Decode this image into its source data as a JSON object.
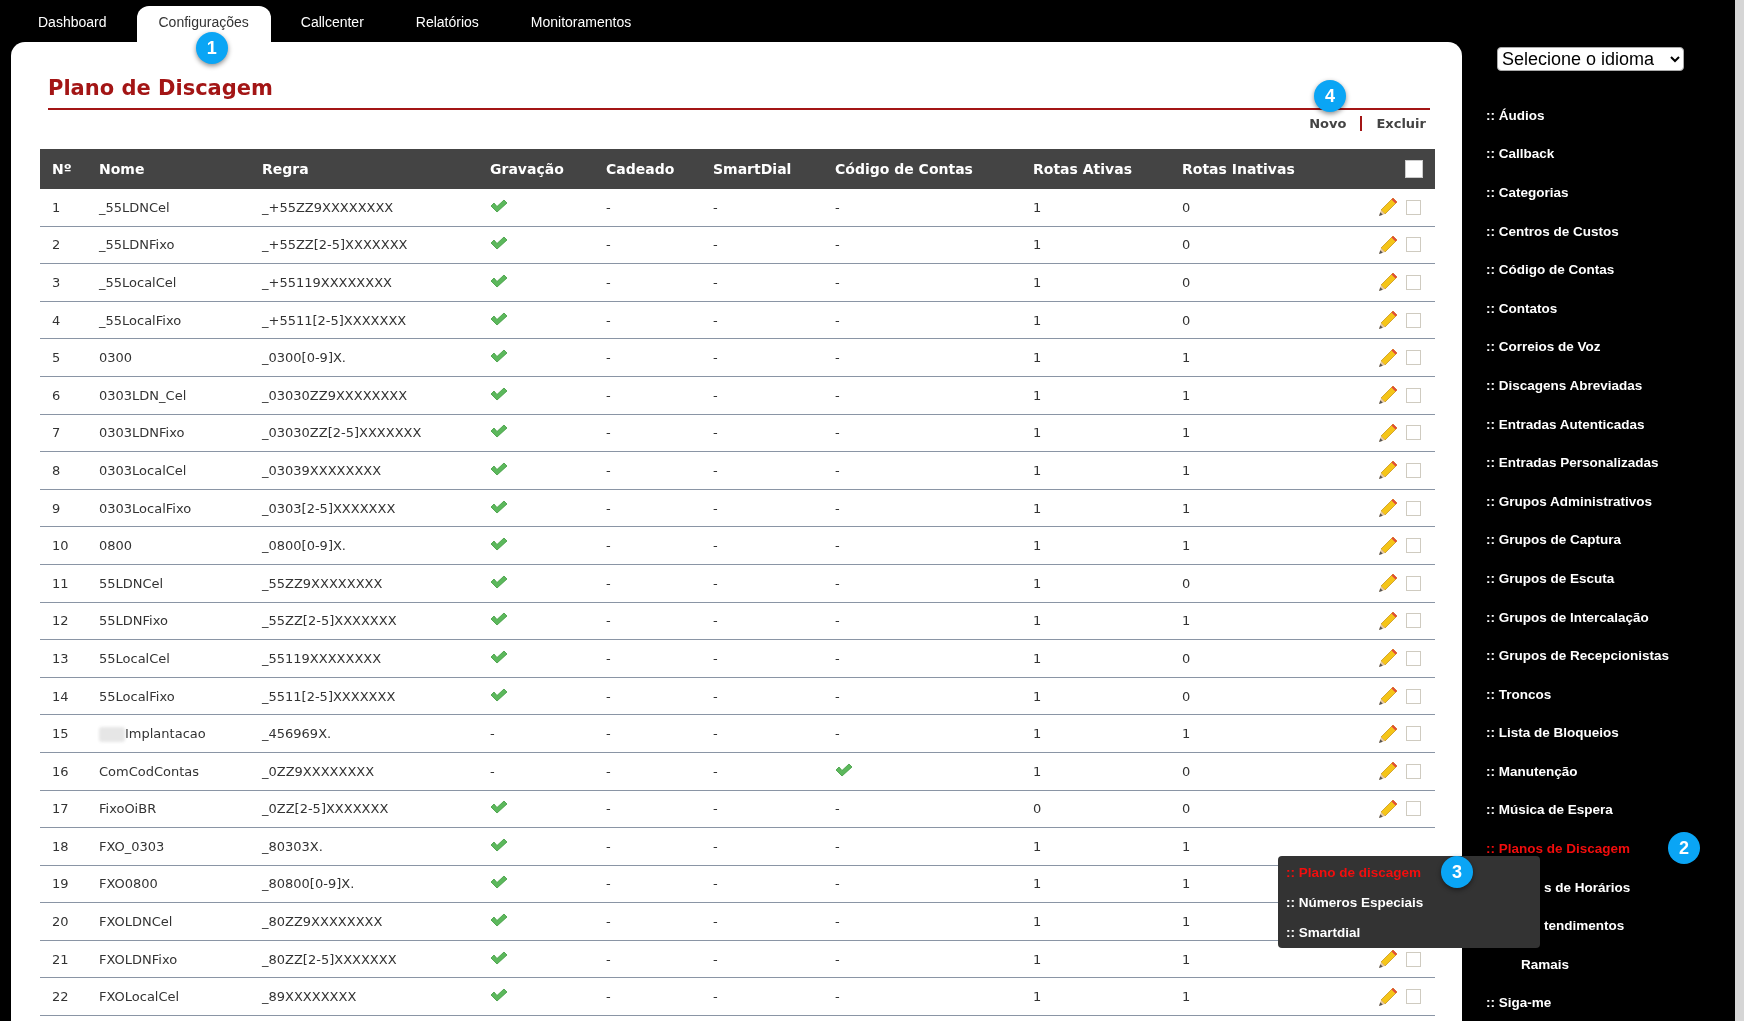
{
  "tabs": [
    {
      "label": "Dashboard",
      "selected": false
    },
    {
      "label": "Configurações",
      "selected": true,
      "badge": "1"
    },
    {
      "label": "Callcenter",
      "selected": false
    },
    {
      "label": "Relatórios",
      "selected": false
    },
    {
      "label": "Monitoramentos",
      "selected": false
    }
  ],
  "page": {
    "title": "Plano de Discagem",
    "badge": "4",
    "actions": [
      "Novo",
      "Excluir"
    ]
  },
  "table": {
    "columns": [
      "Nº",
      "Nome",
      "Regra",
      "Gravação",
      "Cadeado",
      "SmartDial",
      "Código de Contas",
      "Rotas Ativas",
      "Rotas Inativas"
    ],
    "select_all": {
      "checked": false
    },
    "rows": [
      {
        "n": "1",
        "name": "_55LDNCel",
        "rule": "_+55ZZ9XXXXXXXX",
        "recording": true,
        "lock": "-",
        "smartdial": "-",
        "codes": "-",
        "active": "1",
        "inactive": "0",
        "checked": false
      },
      {
        "n": "2",
        "name": "_55LDNFixo",
        "rule": "_+55ZZ[2-5]XXXXXXX",
        "recording": true,
        "lock": "-",
        "smartdial": "-",
        "codes": "-",
        "active": "1",
        "inactive": "0",
        "checked": false
      },
      {
        "n": "3",
        "name": "_55LocalCel",
        "rule": "_+55119XXXXXXXX",
        "recording": true,
        "lock": "-",
        "smartdial": "-",
        "codes": "-",
        "active": "1",
        "inactive": "0",
        "checked": false
      },
      {
        "n": "4",
        "name": "_55LocalFixo",
        "rule": "_+5511[2-5]XXXXXXX",
        "recording": true,
        "lock": "-",
        "smartdial": "-",
        "codes": "-",
        "active": "1",
        "inactive": "0",
        "checked": false
      },
      {
        "n": "5",
        "name": "0300",
        "rule": "_0300[0-9]X.",
        "recording": true,
        "lock": "-",
        "smartdial": "-",
        "codes": "-",
        "active": "1",
        "inactive": "1",
        "checked": false
      },
      {
        "n": "6",
        "name": "0303LDN_Cel",
        "rule": "_03030ZZ9XXXXXXXX",
        "recording": true,
        "lock": "-",
        "smartdial": "-",
        "codes": "-",
        "active": "1",
        "inactive": "1",
        "checked": false
      },
      {
        "n": "7",
        "name": "0303LDNFixo",
        "rule": "_03030ZZ[2-5]XXXXXXX",
        "recording": true,
        "lock": "-",
        "smartdial": "-",
        "codes": "-",
        "active": "1",
        "inactive": "1",
        "checked": false
      },
      {
        "n": "8",
        "name": "0303LocalCel",
        "rule": "_03039XXXXXXXX",
        "recording": true,
        "lock": "-",
        "smartdial": "-",
        "codes": "-",
        "active": "1",
        "inactive": "1",
        "checked": false
      },
      {
        "n": "9",
        "name": "0303LocalFixo",
        "rule": "_0303[2-5]XXXXXXX",
        "recording": true,
        "lock": "-",
        "smartdial": "-",
        "codes": "-",
        "active": "1",
        "inactive": "1",
        "checked": false
      },
      {
        "n": "10",
        "name": "0800",
        "rule": "_0800[0-9]X.",
        "recording": true,
        "lock": "-",
        "smartdial": "-",
        "codes": "-",
        "active": "1",
        "inactive": "1",
        "checked": false
      },
      {
        "n": "11",
        "name": "55LDNCel",
        "rule": "_55ZZ9XXXXXXXX",
        "recording": true,
        "lock": "-",
        "smartdial": "-",
        "codes": "-",
        "active": "1",
        "inactive": "0",
        "checked": false
      },
      {
        "n": "12",
        "name": "55LDNFixo",
        "rule": "_55ZZ[2-5]XXXXXXX",
        "recording": true,
        "lock": "-",
        "smartdial": "-",
        "codes": "-",
        "active": "1",
        "inactive": "1",
        "checked": false
      },
      {
        "n": "13",
        "name": "55LocalCel",
        "rule": "_55119XXXXXXXX",
        "recording": true,
        "lock": "-",
        "smartdial": "-",
        "codes": "-",
        "active": "1",
        "inactive": "0",
        "checked": false
      },
      {
        "n": "14",
        "name": "55LocalFixo",
        "rule": "_5511[2-5]XXXXXXX",
        "recording": true,
        "lock": "-",
        "smartdial": "-",
        "codes": "-",
        "active": "1",
        "inactive": "0",
        "checked": false
      },
      {
        "n": "15",
        "name": "Implantacao",
        "redacted": true,
        "rule": "_456969X.",
        "recording": "-",
        "lock": "-",
        "smartdial": "-",
        "codes": "-",
        "active": "1",
        "inactive": "1",
        "checked": false
      },
      {
        "n": "16",
        "name": "ComCodContas",
        "rule": "_0ZZ9XXXXXXXX",
        "recording": "-",
        "lock": "-",
        "smartdial": "-",
        "codes": true,
        "active": "1",
        "inactive": "0",
        "checked": false
      },
      {
        "n": "17",
        "name": "FixoOiBR",
        "rule": "_0ZZ[2-5]XXXXXXX",
        "recording": true,
        "lock": "-",
        "smartdial": "-",
        "codes": "-",
        "active": "0",
        "inactive": "0",
        "checked": false
      },
      {
        "n": "18",
        "name": "FXO_0303",
        "rule": "_80303X.",
        "recording": true,
        "lock": "-",
        "smartdial": "-",
        "codes": "-",
        "active": "1",
        "inactive": "1"
      },
      {
        "n": "19",
        "name": "FXO0800",
        "rule": "_80800[0-9]X.",
        "recording": true,
        "lock": "-",
        "smartdial": "-",
        "codes": "-",
        "active": "1",
        "inactive": "1"
      },
      {
        "n": "20",
        "name": "FXOLDNCel",
        "rule": "_80ZZ9XXXXXXXX",
        "recording": true,
        "lock": "-",
        "smartdial": "-",
        "codes": "-",
        "active": "1",
        "inactive": "1"
      },
      {
        "n": "21",
        "name": "FXOLDNFixo",
        "rule": "_80ZZ[2-5]XXXXXXX",
        "recording": true,
        "lock": "-",
        "smartdial": "-",
        "codes": "-",
        "active": "1",
        "inactive": "1",
        "checked": false
      },
      {
        "n": "22",
        "name": "FXOLocalCel",
        "rule": "_89XXXXXXXX",
        "recording": true,
        "lock": "-",
        "smartdial": "-",
        "codes": "-",
        "active": "1",
        "inactive": "1",
        "checked": false
      }
    ]
  },
  "sidebar": {
    "language_select": {
      "value": "Selecione o idioma"
    },
    "items": [
      {
        "label": ":: Áudios",
        "selected": false
      },
      {
        "label": ":: Callback",
        "selected": false
      },
      {
        "label": ":: Categorias",
        "selected": false
      },
      {
        "label": ":: Centros de Custos",
        "selected": false
      },
      {
        "label": ":: Código de Contas",
        "selected": false
      },
      {
        "label": ":: Contatos",
        "selected": false
      },
      {
        "label": ":: Correios de Voz",
        "selected": false
      },
      {
        "label": ":: Discagens Abreviadas",
        "selected": false
      },
      {
        "label": ":: Entradas Autenticadas",
        "selected": false
      },
      {
        "label": ":: Entradas Personalizadas",
        "selected": false
      },
      {
        "label": ":: Grupos Administrativos",
        "selected": false
      },
      {
        "label": ":: Grupos de Captura",
        "selected": false
      },
      {
        "label": ":: Grupos de Escuta",
        "selected": false
      },
      {
        "label": ":: Grupos de Intercalação",
        "selected": false
      },
      {
        "label": ":: Grupos de Recepcionistas",
        "selected": false
      },
      {
        "label": ":: Troncos",
        "selected": false
      },
      {
        "label": ":: Lista de Bloqueios",
        "selected": false
      },
      {
        "label": ":: Manutenção",
        "selected": false
      },
      {
        "label": ":: Música de Espera",
        "selected": false
      },
      {
        "label": ":: Planos de Discagem",
        "selected": true,
        "badge": "2"
      },
      {
        "label": "s de Horários",
        "selected": false,
        "kind": "partial"
      },
      {
        "label": "tendimentos",
        "selected": false,
        "kind": "partial"
      },
      {
        "label": "Ramais",
        "selected": false,
        "kind": "covered"
      },
      {
        "label": ":: Siga-me",
        "selected": false
      }
    ]
  },
  "submenu": {
    "items": [
      {
        "label": ":: Plano de discagem",
        "selected": true,
        "badge": "3"
      },
      {
        "label": ":: Números Especiais",
        "selected": false
      },
      {
        "label": ":: Smartdial",
        "selected": false
      }
    ]
  }
}
